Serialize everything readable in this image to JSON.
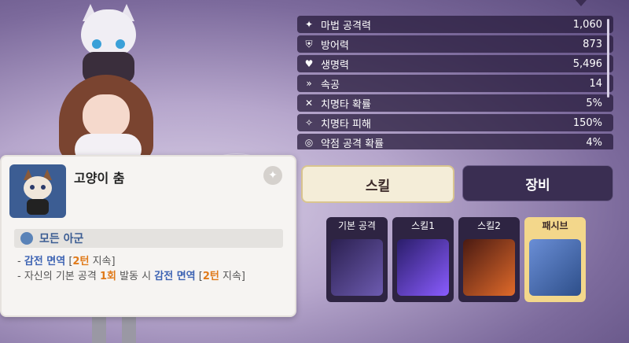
{
  "stats": [
    {
      "icon": "wand-icon",
      "label": "마법 공격력",
      "value": "1,060"
    },
    {
      "icon": "shield-icon",
      "label": "방어력",
      "value": "873"
    },
    {
      "icon": "heart-icon",
      "label": "생명력",
      "value": "5,496"
    },
    {
      "icon": "speed-icon",
      "label": "속공",
      "value": "14"
    },
    {
      "icon": "crit-icon",
      "label": "치명타 확률",
      "value": "5%"
    },
    {
      "icon": "crit-damage-icon",
      "label": "치명타 피해",
      "value": "150%"
    },
    {
      "icon": "weak-icon",
      "label": "약점 공격 확률",
      "value": "4%"
    }
  ],
  "tabs": {
    "skill": "스킬",
    "equip": "장비"
  },
  "skills": [
    {
      "label": "기본 공격",
      "color": "#4a3d78"
    },
    {
      "label": "스킬1",
      "color": "#5b3ea8"
    },
    {
      "label": "스킬2",
      "color": "#b8441f"
    },
    {
      "label": "패시브",
      "color": "#3c5d93"
    }
  ],
  "tooltip": {
    "title": "고양이 춤",
    "target": "모든 아군",
    "line1": {
      "prefix": "- ",
      "effect": "감전 면역",
      "open": " [",
      "duration": "2턴",
      "close": " 지속]"
    },
    "line2": {
      "prefix": "- 자신의 기본 공격 ",
      "count": "1회",
      "mid": " 발동 시 ",
      "effect": "감전 면역",
      "open": " [",
      "duration": "2턴",
      "close": " 지속]"
    }
  },
  "colors": {
    "accent_orange": "#e07a1a",
    "accent_blue": "#3d63b3"
  }
}
